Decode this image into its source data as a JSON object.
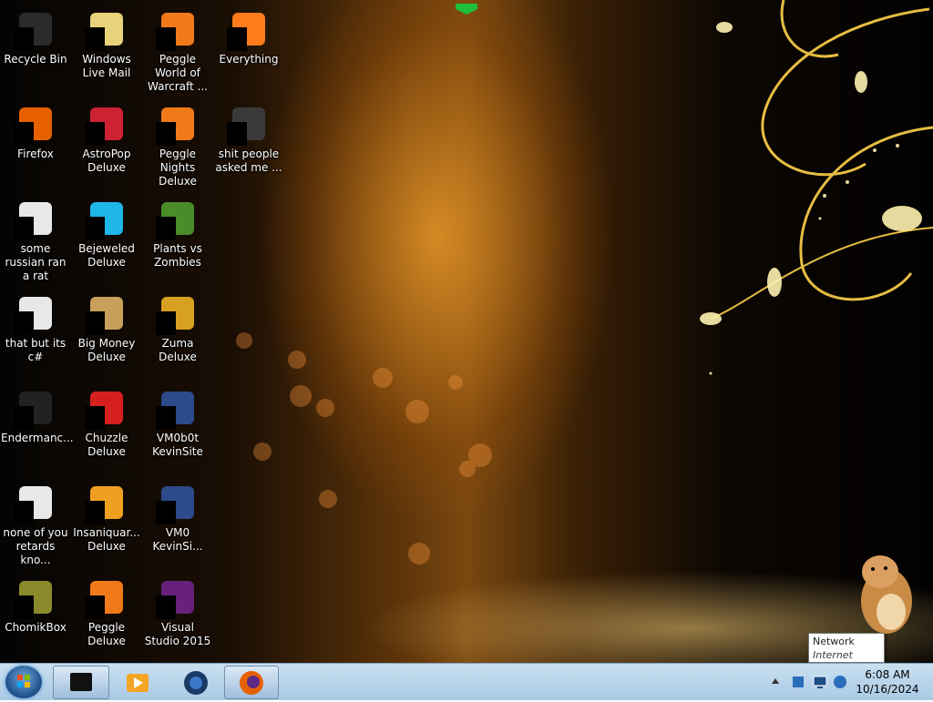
{
  "desktop": {
    "icons": [
      {
        "label": "Recycle Bin",
        "icon": "recycle-bin-icon"
      },
      {
        "label": "Windows Live Mail",
        "icon": "mail-icon"
      },
      {
        "label": "Peggle World of Warcraft ...",
        "icon": "peggle-icon"
      },
      {
        "label": "Everything",
        "icon": "search-app-icon"
      },
      {
        "label": "Firefox",
        "icon": "firefox-icon"
      },
      {
        "label": "AstroPop Deluxe",
        "icon": "astropop-icon"
      },
      {
        "label": "Peggle Nights Deluxe",
        "icon": "peggle-icon"
      },
      {
        "label": "shit people asked me ...",
        "icon": "folder-icon"
      },
      {
        "label": "some russian ran a rat",
        "icon": "shortcut-icon"
      },
      {
        "label": "Bejeweled Deluxe",
        "icon": "bejeweled-icon"
      },
      {
        "label": "Plants vs Zombies",
        "icon": "plants-vs-zombies-icon"
      },
      {
        "label": "that but its c#",
        "icon": "shortcut-icon"
      },
      {
        "label": "Big Money Deluxe",
        "icon": "game-icon"
      },
      {
        "label": "Zuma Deluxe",
        "icon": "zuma-icon"
      },
      {
        "label": "Endermanc...",
        "icon": "terminal-icon"
      },
      {
        "label": "Chuzzle Deluxe",
        "icon": "chuzzle-icon"
      },
      {
        "label": "VM0b0t KevinSite",
        "icon": "app-icon"
      },
      {
        "label": "none of you retards kno...",
        "icon": "shortcut-icon"
      },
      {
        "label": "Insaniquar... Deluxe",
        "icon": "insaniquarium-icon"
      },
      {
        "label": "VM0 KevinSi...",
        "icon": "app-icon"
      },
      {
        "label": "ChomikBox",
        "icon": "hamster-icon"
      },
      {
        "label": "Peggle Deluxe",
        "icon": "peggle-icon"
      },
      {
        "label": "Visual Studio 2015",
        "icon": "visual-studio-icon"
      }
    ]
  },
  "tooltip": {
    "title": "Network",
    "subtitle": "Internet access"
  },
  "taskbar": {
    "items": [
      {
        "name": "window-icon"
      },
      {
        "name": "media-player-icon"
      },
      {
        "name": "app-icon"
      },
      {
        "name": "firefox-icon"
      }
    ],
    "tray": [
      {
        "name": "notification-icon"
      },
      {
        "name": "network-icon"
      },
      {
        "name": "tray-app-icon"
      }
    ]
  },
  "clock": {
    "time": "6:08 AM",
    "date": "10/16/2024"
  },
  "colors": {
    "taskbar": "#b8d3eb",
    "accent": "#f0a020",
    "firefox": "#e66000",
    "visual_studio": "#68217a"
  }
}
